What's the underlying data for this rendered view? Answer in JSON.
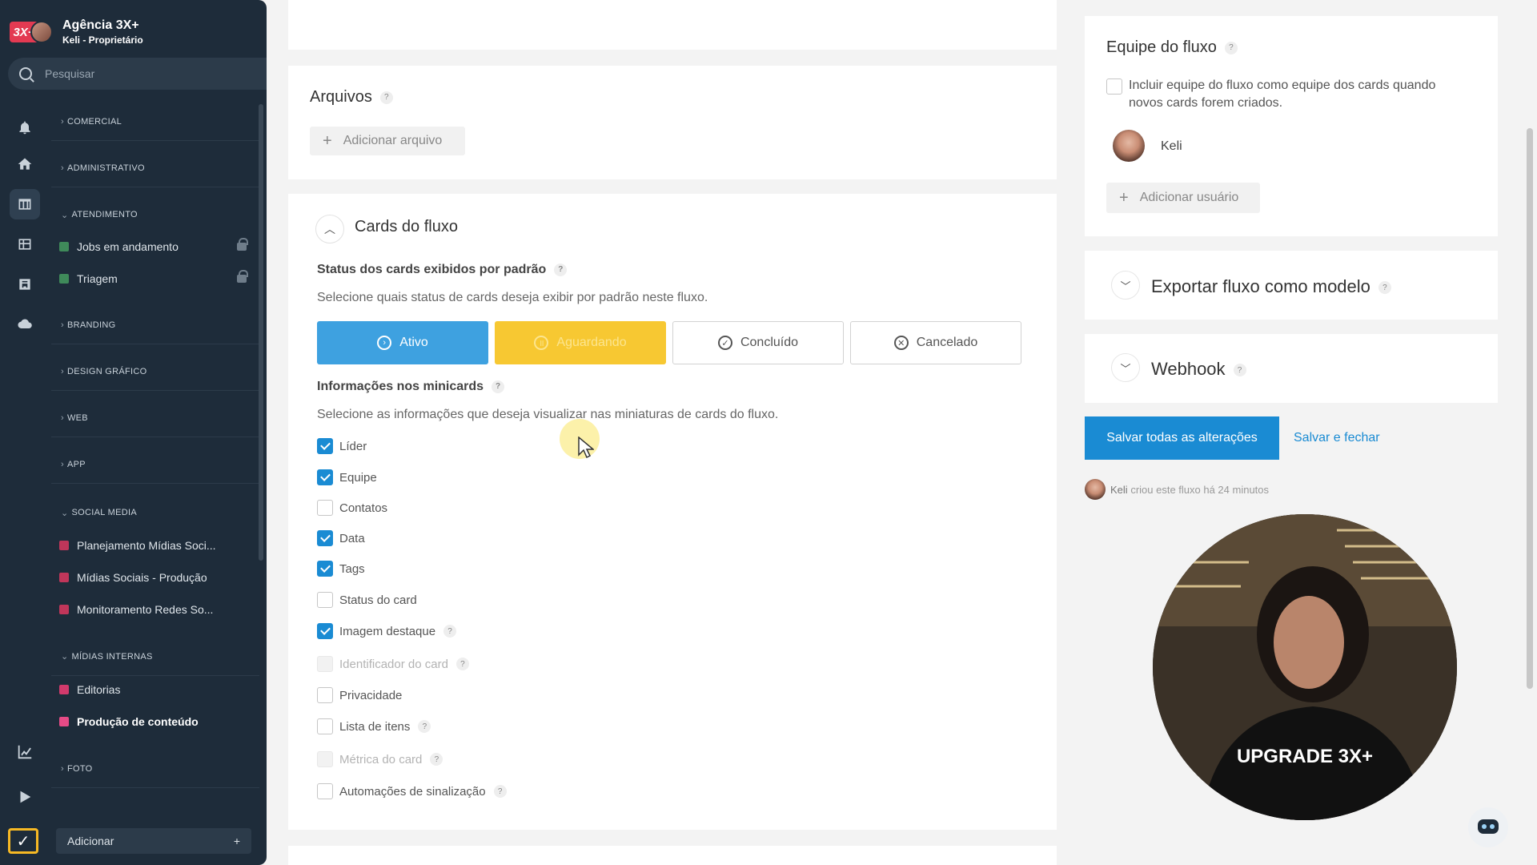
{
  "sidebar": {
    "brand_name": "Agência 3X+",
    "brand_logo": "3X+",
    "user_role": "Keli - Proprietário",
    "search_placeholder": "Pesquisar",
    "sections": [
      {
        "label": "COMERCIAL",
        "expanded": false
      },
      {
        "label": "ADMINISTRATIVO",
        "expanded": false
      },
      {
        "label": "ATENDIMENTO",
        "expanded": true
      },
      {
        "label": "BRANDING",
        "expanded": false
      },
      {
        "label": "DESIGN GRÁFICO",
        "expanded": false
      },
      {
        "label": "WEB",
        "expanded": false
      },
      {
        "label": "APP",
        "expanded": false
      },
      {
        "label": "SOCIAL MEDIA",
        "expanded": true
      },
      {
        "label": "MÍDIAS INTERNAS",
        "expanded": true
      },
      {
        "label": "FOTO",
        "expanded": false
      }
    ],
    "items": [
      {
        "label": "Jobs em andamento",
        "locked": true
      },
      {
        "label": "Triagem",
        "locked": true
      },
      {
        "label": "Planejamento Mídias Soci..."
      },
      {
        "label": "Mídias Sociais - Produção"
      },
      {
        "label": "Monitoramento Redes So..."
      },
      {
        "label": "Editorias"
      },
      {
        "label": "Produção de conteúdo",
        "active": true
      }
    ],
    "add_label": "Adicionar",
    "add_plus": "+"
  },
  "main": {
    "files": {
      "title": "Arquivos",
      "help": "?",
      "add_button": "Adicionar arquivo",
      "plus": "+"
    },
    "cards": {
      "title": "Cards do fluxo",
      "status_title": "Status dos cards exibidos por padrão",
      "status_desc": "Selecione quais status de cards deseja exibir por padrão neste fluxo.",
      "status_buttons": [
        {
          "label": "Ativo",
          "color": "#3ea1e0"
        },
        {
          "label": "Aguardando",
          "color": "#f7c832"
        },
        {
          "label": "Concluído"
        },
        {
          "label": "Cancelado"
        }
      ],
      "mini_title": "Informações nos minicards",
      "mini_desc": "Selecione as informações que deseja visualizar nas miniaturas de cards do fluxo.",
      "options": [
        {
          "label": "Líder",
          "checked": true
        },
        {
          "label": "Equipe",
          "checked": true
        },
        {
          "label": "Contatos",
          "checked": false
        },
        {
          "label": "Data",
          "checked": true
        },
        {
          "label": "Tags",
          "checked": true
        },
        {
          "label": "Status do card",
          "checked": false
        },
        {
          "label": "Imagem destaque",
          "checked": true,
          "help": true
        },
        {
          "label": "Identificador do card",
          "checked": false,
          "disabled": true,
          "help": true
        },
        {
          "label": "Privacidade",
          "checked": false
        },
        {
          "label": "Lista de itens",
          "checked": false,
          "help": true
        },
        {
          "label": "Métrica do card",
          "checked": false,
          "disabled": true,
          "help": true
        },
        {
          "label": "Automações de sinalização",
          "checked": false,
          "help": true
        }
      ]
    }
  },
  "right": {
    "team_title": "Equipe do fluxo",
    "include_team_label": "Incluir equipe do fluxo como equipe dos cards quando novos cards forem criados.",
    "member_name": "Keli",
    "add_user_button": "Adicionar usuário",
    "export_title": "Exportar fluxo como modelo",
    "webhook_title": "Webhook",
    "save_all_button": "Salvar todas as alterações",
    "save_close_link": "Salvar e fechar",
    "created_by": "Keli",
    "created_text": "criou este fluxo há 24 minutos",
    "webcam_caption": "UPGRADE 3X+"
  },
  "colors": {
    "accent": "#1a8bd3",
    "sidebar": "#1e2c3a",
    "active_status": "#3ea1e0",
    "waiting_status": "#f7c832"
  }
}
